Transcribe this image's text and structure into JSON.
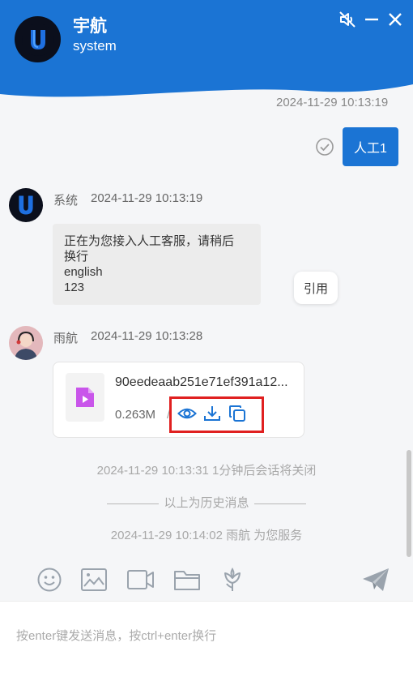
{
  "header": {
    "title": "宇航",
    "subtitle": "system",
    "logo_letter": "U",
    "mute_icon": "speaker-muted-icon",
    "minimize_icon": "minimize-icon",
    "close_icon": "close-icon"
  },
  "messages": {
    "top_timestamp": "2024-11-29 10:13:19",
    "user_message": {
      "text": "人工1",
      "status_icon": "check-circle-icon"
    },
    "system_message": {
      "sender": "系统",
      "time": "2024-11-29 10:13:19",
      "text": "正在为您接入人工客服，请稍后\n换行\nenglish\n123"
    },
    "quote_label": "引用",
    "agent_message": {
      "sender": "雨航",
      "time": "2024-11-29 10:13:28",
      "file": {
        "name": "90eedeaab251e71ef391a12...",
        "size": "0.263M",
        "separator": "/",
        "icon": "video-file-icon",
        "actions": [
          "eye-icon",
          "download-icon",
          "copy-icon"
        ]
      }
    },
    "notice_close": "2024-11-29 10:13:31 1分钟后会话将关闭",
    "history_divider": "以上为历史消息",
    "notice_service": "2024-11-29 10:14:02 雨航 为您服务"
  },
  "toolbar": {
    "icons": [
      "emoji-icon",
      "image-icon",
      "video-icon",
      "folder-icon",
      "flower-icon"
    ],
    "send_icon": "send-icon"
  },
  "input": {
    "placeholder": "按enter键发送消息，按ctrl+enter换行",
    "value": ""
  },
  "colors": {
    "primary": "#1b74d4",
    "highlight": "#e02020",
    "file_icon": "#c955ea"
  }
}
